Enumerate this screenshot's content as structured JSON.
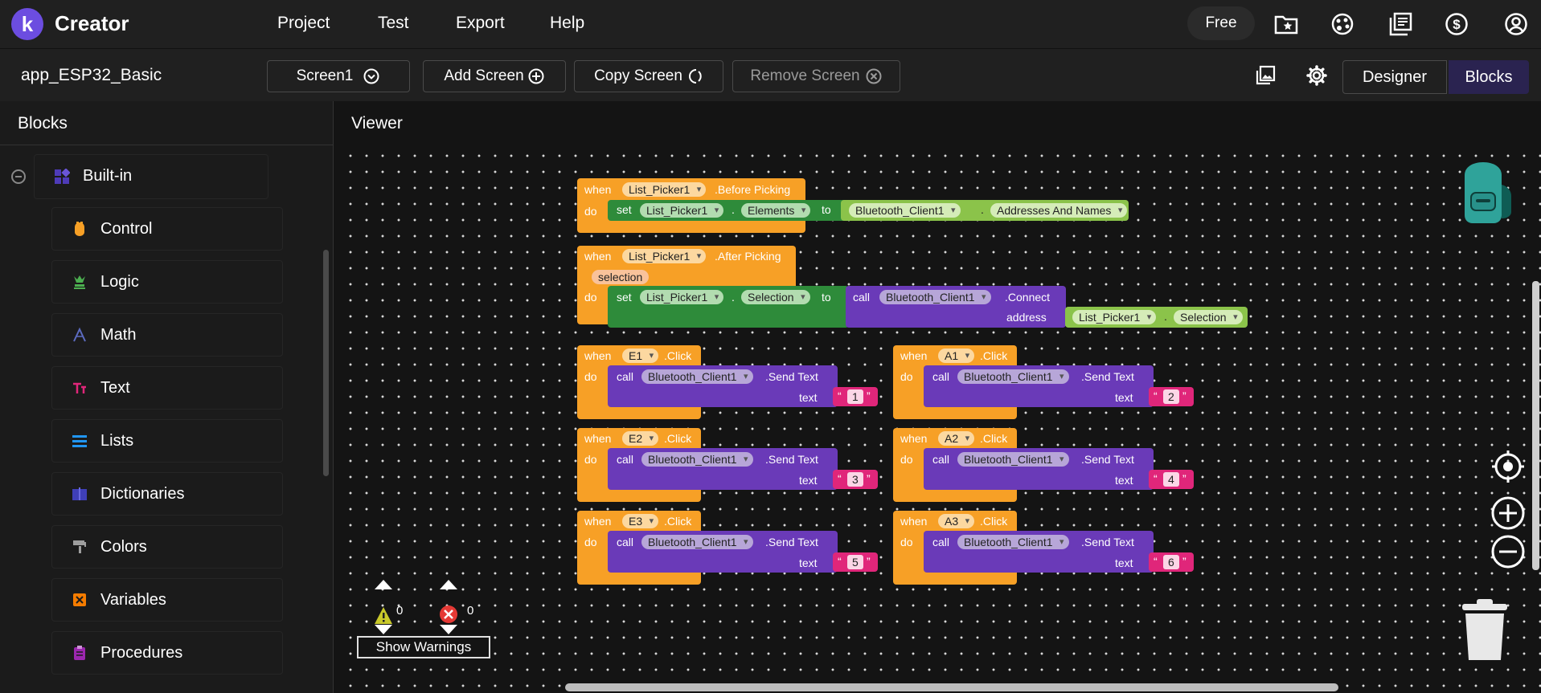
{
  "header": {
    "app_name": "Creator",
    "logo_letter": "k",
    "menu": [
      "Project",
      "Test",
      "Export",
      "Help"
    ],
    "plan_label": "Free",
    "icons": [
      "folder-star-icon",
      "palette-icon",
      "library-icon",
      "dollar-icon",
      "account-icon"
    ]
  },
  "toolbar": {
    "project_name": "app_ESP32_Basic",
    "screen_select": "Screen1",
    "add_screen": "Add Screen",
    "copy_screen": "Copy Screen",
    "remove_screen": "Remove Screen",
    "designer": "Designer",
    "blocks": "Blocks"
  },
  "sidebar": {
    "title": "Blocks",
    "builtin": "Built-in",
    "categories": [
      {
        "label": "Control",
        "icon": "control-icon",
        "color": "#f7a026"
      },
      {
        "label": "Logic",
        "icon": "logic-icon",
        "color": "#4caf50"
      },
      {
        "label": "Math",
        "icon": "math-icon",
        "color": "#3f51b5"
      },
      {
        "label": "Text",
        "icon": "text-icon",
        "color": "#e0267a"
      },
      {
        "label": "Lists",
        "icon": "lists-icon",
        "color": "#2196f3"
      },
      {
        "label": "Dictionaries",
        "icon": "dictionaries-icon",
        "color": "#3f3fb8"
      },
      {
        "label": "Colors",
        "icon": "colors-icon",
        "color": "#9e9e9e"
      },
      {
        "label": "Variables",
        "icon": "variables-icon",
        "color": "#f57c00"
      },
      {
        "label": "Procedures",
        "icon": "procedures-icon",
        "color": "#9c27b0"
      }
    ]
  },
  "viewer": {
    "title": "Viewer",
    "warnings_count": "0",
    "errors_count": "0",
    "show_warnings": "Show Warnings"
  },
  "blocks": {
    "kw_when": "when",
    "kw_do": "do",
    "kw_set": "set",
    "kw_to": "to",
    "kw_call": "call",
    "kw_address": "address",
    "kw_text": "text",
    "dot": ".",
    "list_picker": "List_Picker1",
    "before_picking": ".Before Picking",
    "after_picking": ".After Picking",
    "selection_param": "selection",
    "elements": "Elements",
    "selection": "Selection",
    "bt_client": "Bluetooth_Client1",
    "addresses_names": "Addresses And Names",
    "connect": ".Connect",
    "send_text": ".Send Text",
    "click": ".Click",
    "buttons": [
      {
        "name": "E1",
        "value": "1"
      },
      {
        "name": "A1",
        "value": "2"
      },
      {
        "name": "E2",
        "value": "3"
      },
      {
        "name": "A2",
        "value": "4"
      },
      {
        "name": "E3",
        "value": "5"
      },
      {
        "name": "A3",
        "value": "6"
      }
    ]
  }
}
